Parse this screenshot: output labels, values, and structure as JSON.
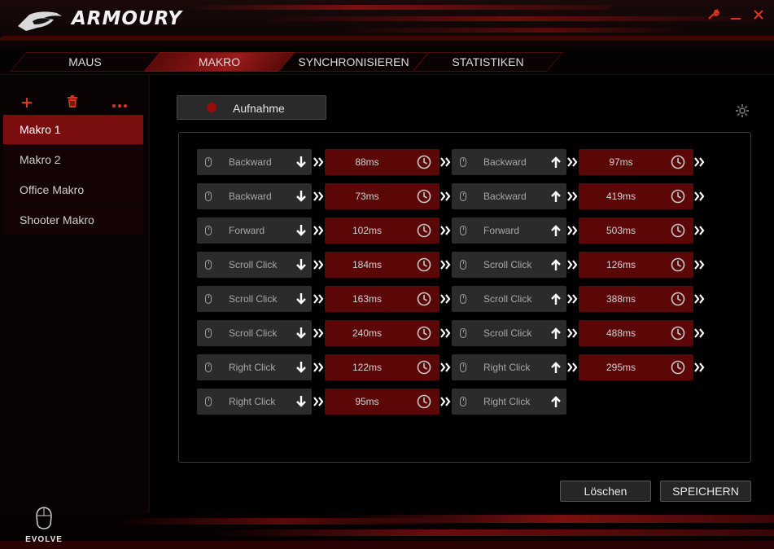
{
  "app": {
    "title": "ARMOURY",
    "logo_icon": "rog-eye-icon",
    "accent": "#e0331f",
    "dark_red": "#5c0707",
    "brand_label": "EVOLVE"
  },
  "window_controls": {
    "settings_icon": "wrench-icon",
    "minimize_icon": "minimize-icon",
    "close_icon": "close-icon"
  },
  "tabs": [
    {
      "label": "MAUS",
      "active": false
    },
    {
      "label": "MAKRO",
      "active": true
    },
    {
      "label": "SYNCHRONISIEREN",
      "active": false
    },
    {
      "label": "STATISTIKEN",
      "active": false
    }
  ],
  "sidebar": {
    "tools": [
      "add-icon",
      "trash-icon",
      "more-icon"
    ],
    "items": [
      {
        "label": "Makro 1",
        "active": true
      },
      {
        "label": "Makro 2",
        "active": false
      },
      {
        "label": "Office Makro",
        "active": false
      },
      {
        "label": "Shooter Makro",
        "active": false
      }
    ]
  },
  "recorder": {
    "record_label": "Aufnahme",
    "settings_icon": "gear-icon"
  },
  "macro_steps": [
    {
      "key": "Backward",
      "press_delay": "88ms",
      "release_delay": "97ms"
    },
    {
      "key": "Backward",
      "press_delay": "73ms",
      "release_delay": "419ms"
    },
    {
      "key": "Forward",
      "press_delay": "102ms",
      "release_delay": "503ms"
    },
    {
      "key": "Scroll Click",
      "press_delay": "184ms",
      "release_delay": "126ms"
    },
    {
      "key": "Scroll Click",
      "press_delay": "163ms",
      "release_delay": "388ms"
    },
    {
      "key": "Scroll Click",
      "press_delay": "240ms",
      "release_delay": "488ms"
    },
    {
      "key": "Right Click",
      "press_delay": "122ms",
      "release_delay": "295ms"
    },
    {
      "key": "Right Click",
      "press_delay": "95ms",
      "release_delay": null
    }
  ],
  "actions": {
    "delete_label": "Löschen",
    "save_label": "SPEICHERN"
  }
}
